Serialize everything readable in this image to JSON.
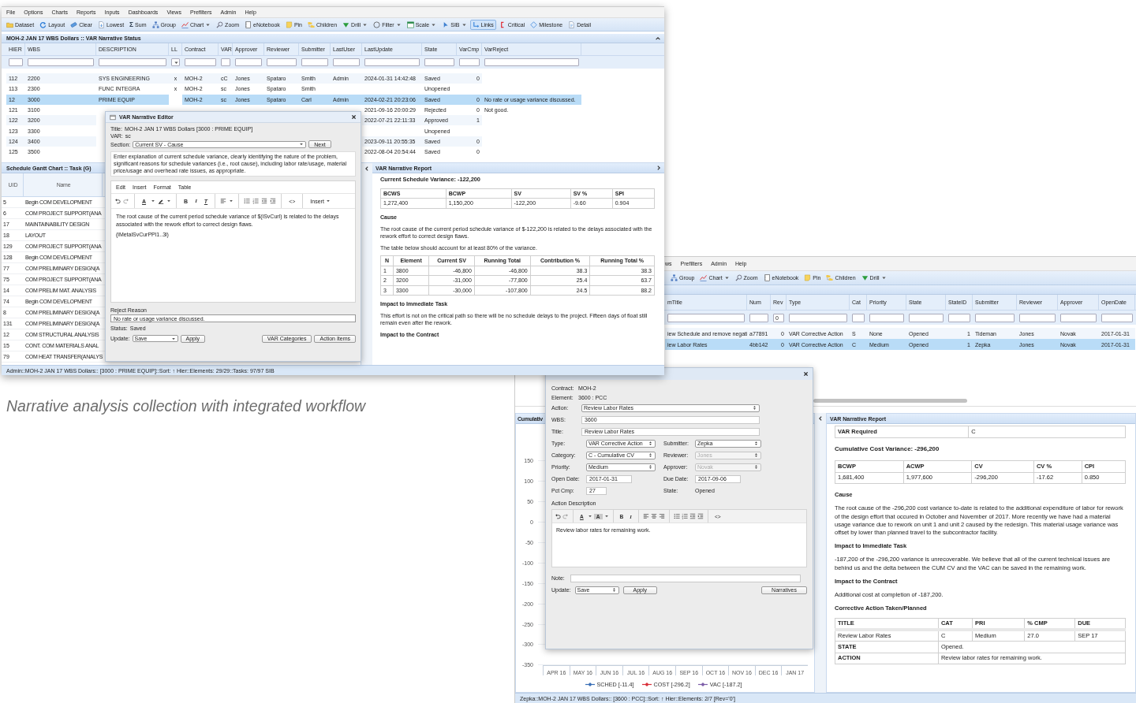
{
  "caption": "Narrative analysis collection with integrated workflow",
  "main_window": {
    "menu": [
      "File",
      "Options",
      "Charts",
      "Reports",
      "Inputs",
      "Dashboards",
      "Views",
      "Prefilters",
      "Admin",
      "Help"
    ],
    "toolbar": [
      {
        "label": "Dataset",
        "kind": "folder",
        "dropdown": false,
        "selected": false
      },
      {
        "label": "Layout",
        "kind": "refresh",
        "dropdown": false,
        "selected": false
      },
      {
        "label": "Clear",
        "kind": "eraser",
        "dropdown": false,
        "selected": false
      },
      {
        "label": "Lowest",
        "kind": "document",
        "dropdown": false,
        "selected": false
      },
      {
        "label": "Sum",
        "kind": "sum",
        "glyph": "Σ",
        "dropdown": false,
        "selected": false
      },
      {
        "label": "Group",
        "kind": "hierarchy",
        "dropdown": false,
        "selected": false
      },
      {
        "label": "Chart",
        "kind": "line-chart",
        "dropdown": true,
        "selected": false
      },
      {
        "label": "Zoom",
        "kind": "magnifier",
        "dropdown": false,
        "selected": false
      },
      {
        "label": "eNotebook",
        "kind": "notebook",
        "dropdown": false,
        "selected": false
      },
      {
        "label": "Pin",
        "kind": "sticky-note",
        "dropdown": false,
        "selected": false
      },
      {
        "label": "Children",
        "kind": "folders",
        "dropdown": false,
        "selected": false
      },
      {
        "label": "Drill",
        "kind": "triangle",
        "dropdown": true,
        "selected": false
      },
      {
        "label": "Filter",
        "kind": "circle",
        "dropdown": true,
        "selected": false
      },
      {
        "label": "Scale",
        "kind": "window",
        "dropdown": true,
        "selected": false
      },
      {
        "label": "SIB",
        "kind": "pointer",
        "dropdown": true,
        "selected": false
      },
      {
        "label": "Links",
        "kind": "connector",
        "dropdown": false,
        "selected": true
      },
      {
        "label": "Critical",
        "kind": "bracket",
        "dropdown": false,
        "selected": false
      },
      {
        "label": "Milestone",
        "kind": "diamond",
        "dropdown": false,
        "selected": false
      },
      {
        "label": "Detail",
        "kind": "page",
        "dropdown": false,
        "selected": false
      }
    ],
    "grid": {
      "title": "MOH-2 JAN 17 WBS Dollars :: VAR Narrative Status",
      "columns": [
        {
          "label": "HIER",
          "kind": "text"
        },
        {
          "label": "WBS",
          "kind": "text"
        },
        {
          "label": "DESCRIPTION",
          "kind": "text"
        },
        {
          "label": "LL",
          "kind": "dropdown"
        },
        {
          "label": "Contract",
          "kind": "text"
        },
        {
          "label": "VAR",
          "kind": "text"
        },
        {
          "label": "Approver",
          "kind": "text"
        },
        {
          "label": "Reviewer",
          "kind": "text"
        },
        {
          "label": "Submitter",
          "kind": "text"
        },
        {
          "label": "LastUser",
          "kind": "text"
        },
        {
          "label": "LastUpdate",
          "kind": "text"
        },
        {
          "label": "State",
          "kind": "text"
        },
        {
          "label": "VarCmp",
          "kind": "text"
        },
        {
          "label": "VarReject",
          "kind": "text"
        }
      ],
      "rows": [
        {
          "selected": false,
          "cells": [
            "112",
            "2200",
            "SYS ENGINEERING",
            "x",
            "MOH-2",
            "cC",
            "Jones",
            "Spataro",
            "Smith",
            "Admin",
            "2024-01-31 14:42:48",
            "Saved",
            "0",
            null
          ]
        },
        {
          "selected": false,
          "cells": [
            "113",
            "2300",
            "FUNC INTEGRA",
            "x",
            "MOH-2",
            "sc",
            "Jones",
            "Spataro",
            "Smith",
            null,
            null,
            "Unopened",
            null,
            null
          ]
        },
        {
          "selected": true,
          "cells": [
            "12",
            "3000",
            "PRIME EQUIP",
            null,
            "MOH-2",
            "sc",
            "Jones",
            "Spataro",
            "Carl",
            "Admin",
            "2024-02-21 20:23:06",
            "Saved",
            "0",
            "No rate or usage variance discussed."
          ]
        },
        {
          "selected": false,
          "cells": [
            "121",
            "3100",
            null,
            null,
            null,
            null,
            null,
            null,
            null,
            null,
            "2021-09-16 20:00:29",
            "Rejected",
            "0",
            "Not good."
          ]
        },
        {
          "selected": false,
          "cells": [
            "122",
            "3200",
            null,
            null,
            null,
            null,
            null,
            null,
            null,
            null,
            "2022-07-21 22:11:33",
            "Approved",
            "1",
            null
          ]
        },
        {
          "selected": false,
          "cells": [
            "123",
            "3300",
            null,
            null,
            null,
            null,
            null,
            null,
            null,
            null,
            null,
            "Unopened",
            null,
            null
          ]
        },
        {
          "selected": false,
          "cells": [
            "124",
            "3400",
            null,
            null,
            null,
            null,
            null,
            null,
            null,
            null,
            "2023-09-11 20:55:35",
            "Saved",
            "0",
            null
          ]
        },
        {
          "selected": false,
          "cells": [
            "125",
            "3500",
            null,
            null,
            null,
            null,
            null,
            null,
            null,
            null,
            "2022-08-04 20:54:44",
            "Saved",
            "0",
            null
          ]
        }
      ]
    },
    "gantt": {
      "title": "Schedule Gantt Chart :: Task (G)",
      "columns": [
        "UID",
        "Name"
      ],
      "rows": [
        [
          "5",
          "Begin COM DEVELOPMENT"
        ],
        [
          "6",
          "COM PROJECT SUPPORT(ANA"
        ],
        [
          "17",
          "MAINTAINABILITY DESIGN"
        ],
        [
          "18",
          "LAYOUT"
        ],
        [
          "129",
          "COM PROJECT SUPPORT(ANA"
        ],
        [
          "128",
          "Begin COM DEVELOPMENT"
        ],
        [
          "77",
          "COM PRELIMINARY DESIGN(A"
        ],
        [
          "75",
          "COM PROJECT SUPPORT(ANA"
        ],
        [
          "14",
          "COM PRELIM MAT. ANALYSIS"
        ],
        [
          "74",
          "Begin COM DEVELOPMENT"
        ],
        [
          "8",
          "COM PRELIMINARY DESIGN(A"
        ],
        [
          "131",
          "COM PRELIMINARY DESIGN(A"
        ],
        [
          "12",
          "COM STRUCTURAL ANALYSIS"
        ],
        [
          "15",
          "CONT. COM MATERIALS ANAL"
        ],
        [
          "79",
          "COM HEAT TRANSFER(ANALYS"
        ]
      ]
    },
    "report": {
      "title": "VAR Narrative Report",
      "blocks": [
        {
          "kind": "heading",
          "text": "Current Schedule Variance: -122,200"
        },
        {
          "kind": "metrics",
          "columns": [
            "BCWS",
            "BCWP",
            "SV",
            "SV %",
            "SPI"
          ],
          "rows": [
            [
              "1,272,400",
              "1,150,200",
              "-122,200",
              "-9.60",
              "0.904"
            ]
          ]
        },
        {
          "kind": "section",
          "text": "Cause"
        },
        {
          "kind": "para",
          "text": "The root cause of the current period schedule variance of $-122,200 is related to the delays associated with the rework effort to correct design flaws."
        },
        {
          "kind": "para",
          "text": "The table below should account for at least 80% of the variance."
        },
        {
          "kind": "breakdown",
          "columns": [
            "N",
            "Element",
            "Current SV",
            "Running Total",
            "Contribution %",
            "Running Total %"
          ],
          "rows": [
            [
              "1",
              "3800",
              "-46,800",
              "-46,800",
              "38.3",
              "38.3"
            ],
            [
              "2",
              "3200",
              "-31,000",
              "-77,800",
              "25.4",
              "63.7"
            ],
            [
              "3",
              "3300",
              "-30,000",
              "-107,800",
              "24.5",
              "88.2"
            ]
          ]
        },
        {
          "kind": "section",
          "text": "Impact to Immediate Task"
        },
        {
          "kind": "para",
          "text": "This effort is not on the critical path so there will be no schedule delays to the project. Fifteen days of float still remain even after the rework."
        },
        {
          "kind": "section",
          "text": "Impact to the Contract"
        }
      ]
    },
    "editor": {
      "title": "VAR Narrative Editor",
      "info": [
        {
          "label": "Title:",
          "value": "MOH-2 JAN 17 WBS Dollars [3000 : PRIME EQUIP]"
        },
        {
          "label": "VAR:",
          "value": "sc"
        }
      ],
      "section_label": "Section:",
      "section_value": "Current SV - Cause",
      "next_button": "Next",
      "instructions": "Enter explanation of current schedule variance, clearly identifying the nature of the problem, significant reasons for schedule variances (i.e., root cause), including labor rate/usage, material price/usage and overhead rate issues, as appropriate.",
      "menu": [
        "Edit",
        "Insert",
        "Format",
        "Table"
      ],
      "toolbar": [
        {
          "kind": "undo"
        },
        {
          "kind": "redo"
        },
        {
          "kind": "sep"
        },
        {
          "kind": "text-color",
          "text": "A"
        },
        {
          "kind": "caret"
        },
        {
          "kind": "marker"
        },
        {
          "kind": "caret"
        },
        {
          "kind": "sep"
        },
        {
          "kind": "bold",
          "text": "B"
        },
        {
          "kind": "italic",
          "text": "I"
        },
        {
          "kind": "clear-format",
          "text": "T"
        },
        {
          "kind": "sep"
        },
        {
          "kind": "align-left"
        },
        {
          "kind": "caret"
        },
        {
          "kind": "sep"
        },
        {
          "kind": "bullets"
        },
        {
          "kind": "numbers"
        },
        {
          "kind": "outdent"
        },
        {
          "kind": "indent"
        },
        {
          "kind": "sep"
        },
        {
          "kind": "code",
          "text": "<>"
        },
        {
          "kind": "sep"
        },
        {
          "kind": "menu",
          "text": "Insert"
        }
      ],
      "body": [
        "The root cause of the current period schedule variance of $(lSvCurl) is related to the delays associated with the rework effort to correct design flaws.",
        "(lMetalSvCurPPl1..3l)"
      ],
      "reject_label": "Reject Reason",
      "reject_value": "No rate or usage variance discussed.",
      "status_label": "Status:",
      "status_value": "Saved",
      "update_label": "Update:",
      "update_value": "Save",
      "buttons": [
        "Apply",
        "VAR Categories",
        "Action Items"
      ]
    },
    "status_bar": "Admin::MOH-2 JAN 17 WBS Dollars:: [3000 : PRIME EQUIP]::Sort: ↑ Hier::Elements: 29/29::Tasks: 97/97 SIB"
  },
  "action_window": {
    "menu": [
      "ws",
      "Prefilters",
      "Admin",
      "Help"
    ],
    "toolbar": [
      {
        "label": "Group",
        "kind": "hierarchy",
        "dropdown": false,
        "selected": false
      },
      {
        "label": "Chart",
        "kind": "line-chart",
        "dropdown": true,
        "selected": false
      },
      {
        "label": "Zoom",
        "kind": "magnifier",
        "dropdown": false,
        "selected": false
      },
      {
        "label": "eNotebook",
        "kind": "notebook",
        "dropdown": false,
        "selected": false
      },
      {
        "label": "Pin",
        "kind": "sticky-note",
        "dropdown": false,
        "selected": false
      },
      {
        "label": "Children",
        "kind": "folders",
        "dropdown": false,
        "selected": false
      },
      {
        "label": "Drill",
        "kind": "triangle",
        "dropdown": true,
        "selected": false
      }
    ],
    "grid": {
      "columns": [
        {
          "label": "mTitle",
          "kind": "text"
        },
        {
          "label": "Num",
          "kind": "text"
        },
        {
          "label": "Rev",
          "kind": "text",
          "filter_value": "0"
        },
        {
          "label": "Type",
          "kind": "text"
        },
        {
          "label": "Cat",
          "kind": "text"
        },
        {
          "label": "Priority",
          "kind": "text"
        },
        {
          "label": "State",
          "kind": "text"
        },
        {
          "label": "StateID",
          "kind": "text"
        },
        {
          "label": "Submitter",
          "kind": "text"
        },
        {
          "label": "Reviewer",
          "kind": "text"
        },
        {
          "label": "Approver",
          "kind": "text"
        },
        {
          "label": "OpenDate",
          "kind": "text"
        }
      ],
      "rows": [
        {
          "selected": false,
          "cells": [
            "iew Schedule and remove negati",
            "a77891",
            "0",
            "VAR Corrective Action",
            "S",
            "None",
            "Opened",
            "1",
            "Tideman",
            "Jones",
            "Novak",
            "2017-01-31"
          ]
        },
        {
          "selected": true,
          "cells": [
            "iew Labor Rates",
            "4bb142",
            "0",
            "VAR Corrective Action",
            "C",
            "Medium",
            "Opened",
            "1",
            "Zepka",
            "Jones",
            "Novak",
            "2017-01-31"
          ]
        }
      ]
    },
    "chart": {
      "title": "Cumulativ",
      "yticks": [
        "150",
        "100",
        "50",
        "0",
        "-50",
        "-100",
        "-150",
        "-200",
        "-250",
        "-300",
        "-350"
      ],
      "xlabels": [
        "APR 16",
        "MAY 16",
        "JUN 16",
        "JUL 16",
        "AUG 16",
        "SEP 16",
        "OCT 16",
        "NOV 16",
        "DEC 16",
        "JAN 17"
      ],
      "legend": [
        {
          "name": "SCHED [-11.4]",
          "color": "#3b6fb6"
        },
        {
          "name": "COST [-296.2]",
          "color": "#d9303a"
        },
        {
          "name": "VAC [-187.2]",
          "color": "#7d5ea8"
        }
      ]
    },
    "report": {
      "title": "VAR Narrative Report",
      "blocks": [
        {
          "kind": "keyvalue",
          "rows": [
            [
              "VAR Required",
              "C"
            ]
          ]
        },
        {
          "kind": "heading",
          "text": "Cumulative Cost Variance: -296,200"
        },
        {
          "kind": "metrics",
          "columns": [
            "BCWP",
            "ACWP",
            "CV",
            "CV %",
            "CPI"
          ],
          "rows": [
            [
              "1,681,400",
              "1,977,600",
              "-296,200",
              "-17.62",
              "0.850"
            ]
          ]
        },
        {
          "kind": "section",
          "text": "Cause"
        },
        {
          "kind": "para",
          "text": "The root cause of the -296,200 cost variance to-date is related to the additional expenditure of labor for rework of the design effort that occured in October and November of 2017. More recently we have had a material usage variance due to rework on unit 1 and unit 2 caused by the redesign. This material usage variance was offset by lower than planned travel to the subcontractor facility."
        },
        {
          "kind": "section",
          "text": "Impact to Immediate Task"
        },
        {
          "kind": "para",
          "text": "-187,200 of the -296,200 variance is unrecoverable. We believe that all of the current technical issues are behind us and the delta between the CUM CV and the VAC can be saved in the remaining work."
        },
        {
          "kind": "section",
          "text": "Impact to the Contract"
        },
        {
          "kind": "para",
          "text": "Additional cost at completion of -187,200."
        },
        {
          "kind": "section",
          "text": "Corrective Action Taken/Planned"
        },
        {
          "kind": "actions",
          "columns": [
            "TITLE",
            "CAT",
            "PRI",
            "% CMP",
            "DUE"
          ],
          "rows": [
            [
              "Review Labor Rates",
              "C",
              "Medium",
              "27.0",
              "SEP 17"
            ]
          ],
          "details": [
            [
              "STATE",
              "Opened."
            ],
            [
              "ACTION",
              "Review labor rates for remaining work."
            ]
          ]
        }
      ]
    },
    "dialog": {
      "info": [
        {
          "label": "Contract:",
          "value": "MOH-2"
        },
        {
          "label": "Element:",
          "value": "3600 : PCC"
        }
      ],
      "wide_fields": [
        {
          "label": "Action:",
          "kind": "select",
          "value": "Review Labor Rates",
          "disabled": false
        },
        {
          "label": "WBS:",
          "kind": "input",
          "value": "3600"
        },
        {
          "label": "Title:",
          "kind": "input",
          "value": "Review Labor Rates"
        }
      ],
      "pairs": [
        {
          "fields": [
            {
              "label": "Type:",
              "kind": "select",
              "value": "VAR Corrective Action",
              "disabled": false
            },
            {
              "label": "Submitter:",
              "kind": "select",
              "value": "Zepka",
              "disabled": false
            }
          ]
        },
        {
          "fields": [
            {
              "label": "Category:",
              "kind": "select",
              "value": "C - Cumulative CV",
              "disabled": false
            },
            {
              "label": "Reviewer:",
              "kind": "select",
              "value": "Jones",
              "disabled": true
            }
          ]
        },
        {
          "fields": [
            {
              "label": "Priority:",
              "kind": "select",
              "value": "Medium",
              "disabled": false
            },
            {
              "label": "Approver:",
              "kind": "select",
              "value": "Novak",
              "disabled": true
            }
          ]
        },
        {
          "fields": [
            {
              "label": "Open Date:",
              "kind": "input",
              "value": "2017-01-31"
            },
            {
              "label": "Due Date:",
              "kind": "input",
              "value": "2017-09-06"
            }
          ]
        },
        {
          "fields": [
            {
              "label": "Pct Cmp:",
              "kind": "input",
              "value": "27"
            },
            {
              "label": "State:",
              "kind": "text",
              "value": "Opened"
            }
          ]
        }
      ],
      "description_label": "Action Description",
      "toolbar": [
        {
          "kind": "undo"
        },
        {
          "kind": "redo"
        },
        {
          "kind": "sep"
        },
        {
          "kind": "text-color",
          "text": "A"
        },
        {
          "kind": "caret"
        },
        {
          "kind": "highlight-color",
          "text": "A"
        },
        {
          "kind": "caret"
        },
        {
          "kind": "sep"
        },
        {
          "kind": "bold",
          "text": "B"
        },
        {
          "kind": "italic",
          "text": "I"
        },
        {
          "kind": "sep"
        },
        {
          "kind": "align-left"
        },
        {
          "kind": "align-center"
        },
        {
          "kind": "align-right"
        },
        {
          "kind": "sep"
        },
        {
          "kind": "bullets"
        },
        {
          "kind": "numbers"
        },
        {
          "kind": "outdent"
        },
        {
          "kind": "indent"
        },
        {
          "kind": "sep"
        },
        {
          "kind": "code",
          "text": "<>"
        }
      ],
      "description": "Review labor rates for remaining work.",
      "note_label": "Note:",
      "update_label": "Update:",
      "update_value": "Save",
      "buttons": [
        "Apply",
        "Narratives"
      ]
    },
    "status_bar": "Zepka::MOH-2 JAN 17 WBS Dollars:: [3600 : PCC]::Sort: ↑ Hier::Elements: 2/7 [Rev='0']"
  }
}
